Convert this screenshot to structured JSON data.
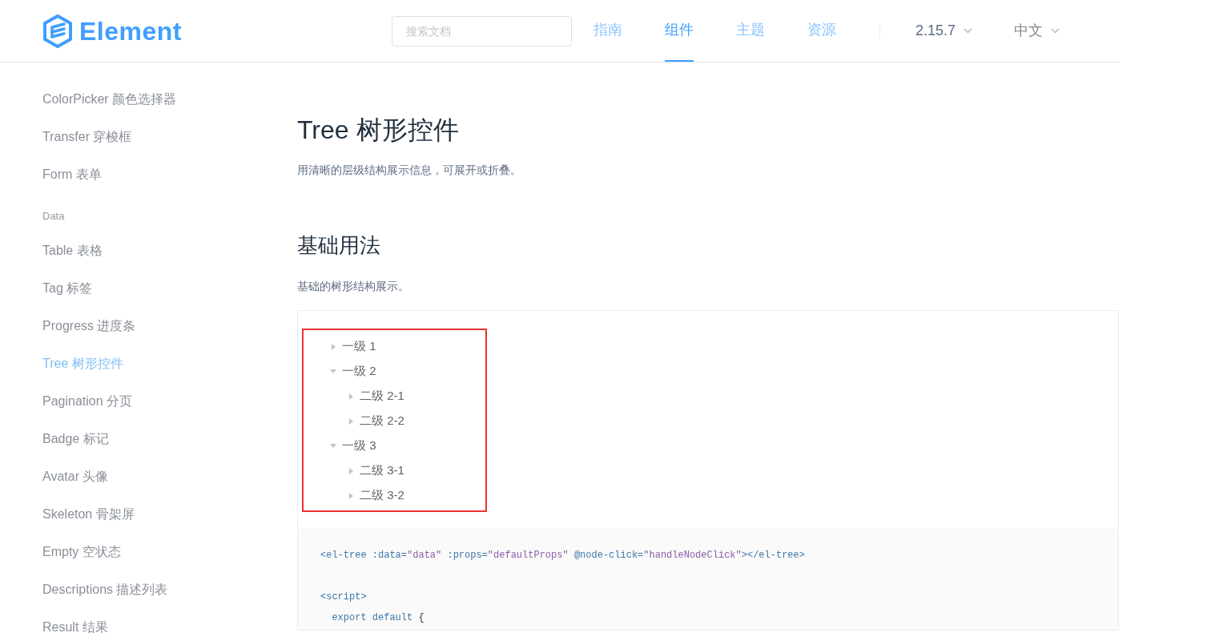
{
  "header": {
    "logo": "Element",
    "search": {
      "placeholder": "搜索文档"
    },
    "nav": [
      {
        "label": "指南",
        "selected": false
      },
      {
        "label": "组件",
        "selected": true
      },
      {
        "label": "主题",
        "selected": false
      },
      {
        "label": "资源",
        "selected": false
      }
    ],
    "version": "2.15.7",
    "language": "中文"
  },
  "sidebar": {
    "groups": [
      {
        "items": [
          {
            "label": "ColorPicker 颜色选择器",
            "selected": false
          },
          {
            "label": "Transfer 穿梭框",
            "selected": false
          },
          {
            "label": "Form 表单",
            "selected": false
          }
        ]
      },
      {
        "title": "Data",
        "items": [
          {
            "label": "Table 表格",
            "selected": false
          },
          {
            "label": "Tag 标签",
            "selected": false
          },
          {
            "label": "Progress 进度条",
            "selected": false
          },
          {
            "label": "Tree 树形控件",
            "selected": true
          },
          {
            "label": "Pagination 分页",
            "selected": false
          },
          {
            "label": "Badge 标记",
            "selected": false
          },
          {
            "label": "Avatar 头像",
            "selected": false
          },
          {
            "label": "Skeleton 骨架屏",
            "selected": false
          },
          {
            "label": "Empty 空状态",
            "selected": false
          },
          {
            "label": "Descriptions 描述列表",
            "selected": false
          },
          {
            "label": "Result 结果",
            "selected": false
          }
        ]
      }
    ]
  },
  "content": {
    "title": "Tree 树形控件",
    "description": "用清晰的层级结构展示信息，可展开或折叠。",
    "section": {
      "title": "基础用法",
      "description": "基础的树形结构展示。",
      "tree": [
        {
          "label": "一级 1",
          "expanded": false
        },
        {
          "label": "一级 2",
          "expanded": true,
          "children": [
            {
              "label": "二级 2-1",
              "expanded": false
            },
            {
              "label": "二级 2-2",
              "expanded": false
            }
          ]
        },
        {
          "label": "一级 3",
          "expanded": true,
          "children": [
            {
              "label": "二级 3-1",
              "expanded": false
            },
            {
              "label": "二级 3-2",
              "expanded": false
            }
          ]
        }
      ],
      "code": [
        {
          "blank_line_before": false,
          "tokens": [
            {
              "kind": "tag",
              "text": "<el-tree"
            },
            {
              "kind": "attr",
              "text": " :data="
            },
            {
              "kind": "string",
              "text": "\"data\""
            },
            {
              "kind": "attr",
              "text": " :props="
            },
            {
              "kind": "string",
              "text": "\"defaultProps\""
            },
            {
              "kind": "attr",
              "text": " @node-click="
            },
            {
              "kind": "string",
              "text": "\"handleNodeClick\""
            },
            {
              "kind": "tag",
              "text": "></el-tree>"
            }
          ]
        },
        {
          "blank_line_before": true,
          "tokens": [
            {
              "kind": "tag",
              "text": "<script>"
            }
          ]
        },
        {
          "blank_line_before": false,
          "tokens": [
            {
              "kind": "keyword",
              "text": "  export default"
            },
            {
              "kind": "punct",
              "text": " {"
            }
          ]
        }
      ]
    }
  }
}
